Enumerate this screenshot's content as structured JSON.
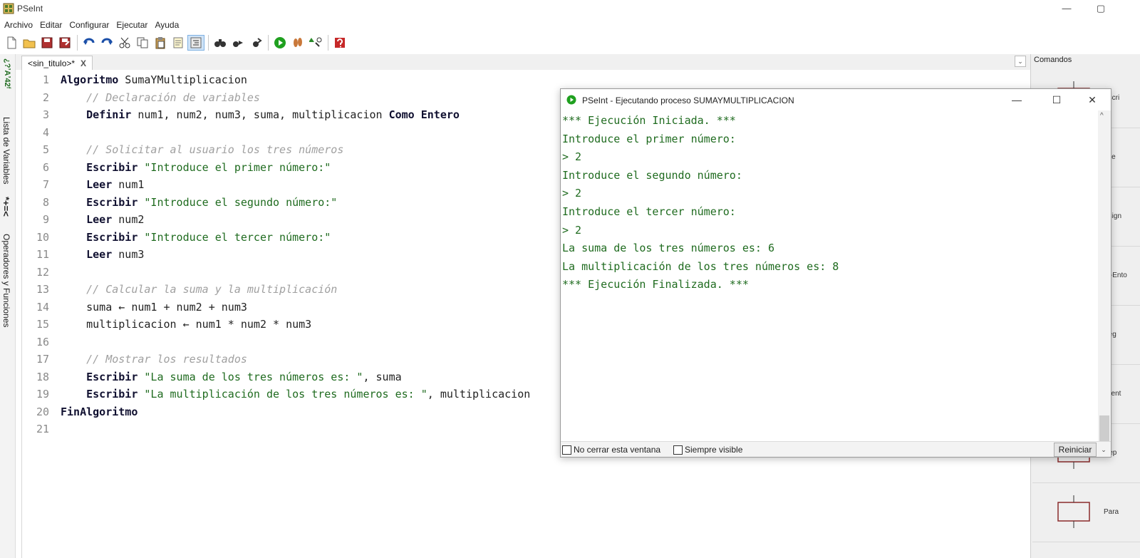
{
  "window": {
    "title": "PSeInt",
    "minimize": "—",
    "maximize": "▢"
  },
  "menu": [
    "Archivo",
    "Editar",
    "Configurar",
    "Ejecutar",
    "Ayuda"
  ],
  "left_panel": {
    "variables_label": "Lista de Variables",
    "operators_label": "Operadores y Funciones",
    "variables_icon_text": "*+=<",
    "operators_icon_text": "¿?ʼAʼ42ᶠ"
  },
  "tab": {
    "label": "<sin_titulo>*",
    "close": "X",
    "dropdown": "⌄"
  },
  "editor": {
    "lines": [
      {
        "n": "1",
        "parts": [
          [
            "kw",
            "Algoritmo"
          ],
          [
            "id",
            " SumaYMultiplicacion"
          ]
        ]
      },
      {
        "n": "2",
        "parts": [
          [
            "cm",
            "    // Declaración de variables"
          ]
        ]
      },
      {
        "n": "3",
        "parts": [
          [
            "kw",
            "    Definir"
          ],
          [
            "id",
            " num1, num2, num3, suma, multiplicacion "
          ],
          [
            "kw",
            "Como Entero"
          ]
        ]
      },
      {
        "n": "4",
        "parts": []
      },
      {
        "n": "5",
        "parts": [
          [
            "cm",
            "    // Solicitar al usuario los tres números"
          ]
        ]
      },
      {
        "n": "6",
        "parts": [
          [
            "kw",
            "    Escribir"
          ],
          [
            "str",
            " \"Introduce el primer número:\""
          ]
        ]
      },
      {
        "n": "7",
        "parts": [
          [
            "kw",
            "    Leer"
          ],
          [
            "id",
            " num1"
          ]
        ]
      },
      {
        "n": "8",
        "parts": [
          [
            "kw",
            "    Escribir"
          ],
          [
            "str",
            " \"Introduce el segundo número:\""
          ]
        ]
      },
      {
        "n": "9",
        "parts": [
          [
            "kw",
            "    Leer"
          ],
          [
            "id",
            " num2"
          ]
        ]
      },
      {
        "n": "10",
        "parts": [
          [
            "kw",
            "    Escribir"
          ],
          [
            "str",
            " \"Introduce el tercer número:\""
          ]
        ]
      },
      {
        "n": "11",
        "parts": [
          [
            "kw",
            "    Leer"
          ],
          [
            "id",
            " num3"
          ]
        ]
      },
      {
        "n": "12",
        "parts": []
      },
      {
        "n": "13",
        "parts": [
          [
            "cm",
            "    // Calcular la suma y la multiplicación"
          ]
        ]
      },
      {
        "n": "14",
        "parts": [
          [
            "id",
            "    suma ← num1 + num2 + num3"
          ]
        ]
      },
      {
        "n": "15",
        "parts": [
          [
            "id",
            "    multiplicacion ← num1 * num2 * num3"
          ]
        ]
      },
      {
        "n": "16",
        "parts": []
      },
      {
        "n": "17",
        "parts": [
          [
            "cm",
            "    // Mostrar los resultados"
          ]
        ]
      },
      {
        "n": "18",
        "parts": [
          [
            "kw",
            "    Escribir"
          ],
          [
            "str",
            " \"La suma de los tres números es: \""
          ],
          [
            "id",
            ", suma"
          ]
        ]
      },
      {
        "n": "19",
        "parts": [
          [
            "kw",
            "    Escribir"
          ],
          [
            "str",
            " \"La multiplicación de los tres números es: \""
          ],
          [
            "id",
            ", multiplicacion"
          ]
        ]
      },
      {
        "n": "20",
        "parts": [
          [
            "kw",
            "FinAlgoritmo"
          ]
        ]
      },
      {
        "n": "21",
        "parts": []
      }
    ]
  },
  "commands_panel": {
    "title": "Comandos",
    "items": [
      "Escri",
      "Lee",
      "Asign",
      "Si-Ento",
      "Seg",
      "Mient",
      "Rep",
      "Para"
    ]
  },
  "run_window": {
    "title": "PSeInt - Ejecutando proceso SUMAYMULTIPLICACION",
    "minimize": "—",
    "maximize": "☐",
    "close": "✕",
    "output": [
      "*** Ejecución Iniciada. ***",
      "Introduce el primer número:",
      "> 2",
      "Introduce el segundo número:",
      "> 2",
      "Introduce el tercer número:",
      "> 2",
      "La suma de los tres números es: 6",
      "La multiplicación de los tres números es: 8",
      "*** Ejecución Finalizada. ***"
    ],
    "keep_open_label": "No cerrar esta ventana",
    "always_visible_label": "Siempre visible",
    "restart_label": "Reiniciar",
    "restart_dropdown": "⌄",
    "scroll_up": "^"
  },
  "colors": {
    "keyword": "#101030",
    "string": "#1f6b1f",
    "comment": "#a0a0a0",
    "console_text": "#1f6b1f",
    "run_icon": "#1fa01f"
  }
}
